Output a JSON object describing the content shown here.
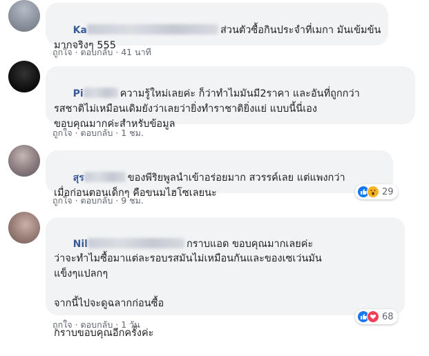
{
  "comments": [
    {
      "author_visible": "Ka",
      "text": "ส่วนตัวซื้อกินประจำที่เมกา มันเข้มข้น\nมากจริงๆ 555",
      "like": "ถูกใจ",
      "reply": "ตอบกลับ",
      "time": "41 นาที"
    },
    {
      "author_visible": "Pi",
      "text": "ความรู้ใหม่เลยค่ะ ก็ว่าทำไมมันมี2ราคา และอันที่ถูกกว่า\nรสชาติไม่เหมือนเดิมยังว่าเลยว่ายิ่งทำราชาติยิ่งแย่ แบบนี้นี่เอง\nขอบคุณมากค่ะสำหรับข้อมูล",
      "like": "ถูกใจ",
      "reply": "ตอบกลับ",
      "time": "1 ชม."
    },
    {
      "author_visible": "สุร",
      "text": "ของพีริยพูลนำเข้าอร่อยมาก สวรรค์เลย แต่แพงกว่า\nเมื่อก่อนตอนเด็กๆ คือขนมไฮโซเลยนะ",
      "like": "ถูกใจ",
      "reply": "ตอบกลับ",
      "time": "9 ชม.",
      "reactions": {
        "count": "29",
        "icons": [
          "like-icon",
          "wow-icon"
        ]
      }
    },
    {
      "author_visible": "Nil",
      "text": "กราบแอด ขอบคุณมากเลยค่ะ\nว่าจะทำไมซื้อมาแต่ละรอบรสมันไม่เหมือนกันและของเซเว่นมัน\nแข็งๆแปลกๆ\n\nจากนี้ไปจะดูฉลากก่อนซื้อ\n\nกราบขอบคุณอีกครั้งค่ะ",
      "like": "ถูกใจ",
      "reply": "ตอบกลับ",
      "time": "1 วัน",
      "reactions": {
        "count": "68",
        "icons": [
          "like-icon",
          "love-icon"
        ]
      }
    }
  ],
  "separator": "·",
  "colors": {
    "name": "#385898",
    "bubble": "#f2f3f5",
    "meta": "#606770",
    "like": "#1877f2",
    "love": "#f33e58",
    "wow": "#f7b125"
  }
}
